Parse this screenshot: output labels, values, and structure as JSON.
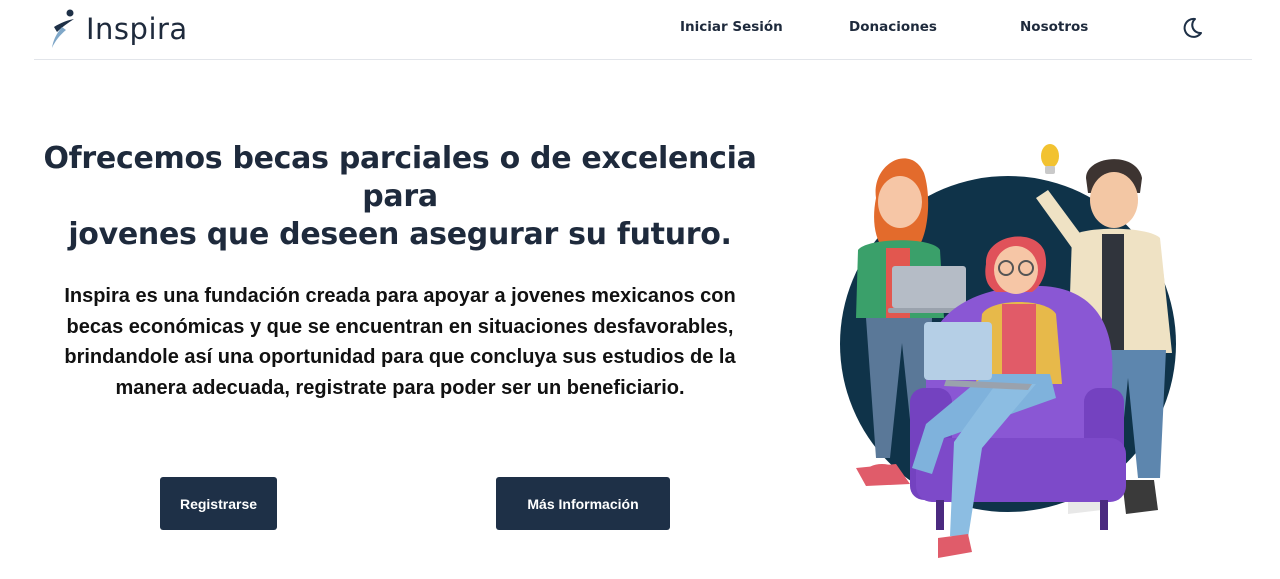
{
  "header": {
    "brand": "Inspira",
    "nav": {
      "login": "Iniciar Sesión",
      "donations": "Donaciones",
      "about": "Nosotros"
    },
    "theme_toggle_icon": "moon-icon"
  },
  "hero": {
    "headline_line1": "Ofrecemos becas parciales o de excelencia para",
    "headline_line2": "jovenes que deseen asegurar su futuro.",
    "description_line1": "Inspira es una fundación creada para apoyar a jovenes mexicanos con",
    "description_line2": "becas económicas y que se encuentran en situaciones desfavorables,",
    "description_line3": "brindandole así una oportunidad para que concluya sus estudios de la",
    "description_line4": "manera adecuada, registrate para poder ser un beneficiario.",
    "register_label": "Registrarse",
    "more_info_label": "Más Información"
  },
  "colors": {
    "primary_dark": "#1e3047",
    "text_dark": "#1e2a3c",
    "circle": "#0f3349",
    "chair": "#8a57d4"
  }
}
